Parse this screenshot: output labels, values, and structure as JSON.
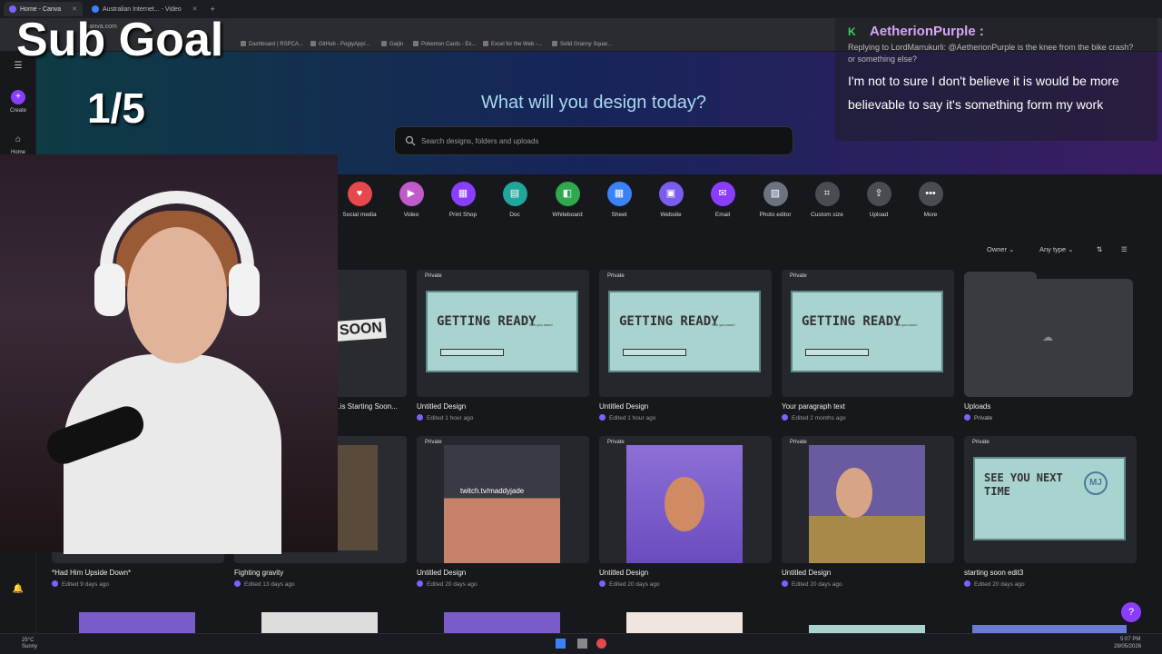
{
  "browser": {
    "tabs": [
      {
        "label": "Home - Canva"
      },
      {
        "label": "Australian Internet... - Video"
      }
    ],
    "url": "canva.com",
    "bookmarks": [
      "Dashboard | RSPCA...",
      "GitHub - PogiyApp/...",
      "Gaijin",
      "Pokemon Cards - Ex...",
      "Excel for the Web -...",
      "Solid Granny Squar..."
    ]
  },
  "sidebar": {
    "create_label": "Create",
    "home_label": "Home"
  },
  "hero": {
    "title": "What will you design today?",
    "search_placeholder": "Search designs, folders and uploads"
  },
  "categories": [
    {
      "label": "Social media",
      "icon": "heart-icon",
      "color": "#e5484d"
    },
    {
      "label": "Video",
      "icon": "video-icon",
      "color": "#c05cc9"
    },
    {
      "label": "Print Shop",
      "icon": "print-icon",
      "color": "#8b3dff"
    },
    {
      "label": "Doc",
      "icon": "doc-icon",
      "color": "#21a69b"
    },
    {
      "label": "Whiteboard",
      "icon": "whiteboard-icon",
      "color": "#2fa84f"
    },
    {
      "label": "Sheet",
      "icon": "sheet-icon",
      "color": "#3b82f6"
    },
    {
      "label": "Website",
      "icon": "website-icon",
      "color": "#7b5cf0"
    },
    {
      "label": "Email",
      "icon": "email-icon",
      "color": "#8b3dff"
    },
    {
      "label": "Photo editor",
      "icon": "photo-icon",
      "color": "#6b7280"
    },
    {
      "label": "Custom size",
      "icon": "crop-icon",
      "color": "#4b4b52"
    },
    {
      "label": "Upload",
      "icon": "upload-icon",
      "color": "#4b4b52"
    },
    {
      "label": "More",
      "icon": "more-icon",
      "color": "#4b4b52"
    }
  ],
  "filters": {
    "owner": "Owner",
    "type": "Any type"
  },
  "designs_row1": [
    {
      "title": "...is Starting Soon...",
      "meta": "",
      "tag": ""
    },
    {
      "title": "Untitled Design",
      "meta": "Edited 1 hour ago",
      "tag": "Private"
    },
    {
      "title": "Untitled Design",
      "meta": "Edited 1 hour ago",
      "tag": "Private"
    },
    {
      "title": "Your paragraph text",
      "meta": "Edited 2 months ago",
      "tag": "Private"
    },
    {
      "title": "Uploads",
      "meta": "Private",
      "tag": ""
    }
  ],
  "designs_row2": [
    {
      "title": "*Had Him Upside Down*",
      "meta": "Edited 9 days ago",
      "tag": ""
    },
    {
      "title": "Fighting gravity",
      "meta": "Edited 13 days ago",
      "tag": ""
    },
    {
      "title": "Untitled Design",
      "meta": "Edited 20 days ago",
      "tag": "Private"
    },
    {
      "title": "Untitled Design",
      "meta": "Edited 20 days ago",
      "tag": "Private"
    },
    {
      "title": "Untitled Design",
      "meta": "Edited 20 days ago",
      "tag": "Private"
    },
    {
      "title": "starting soon edit3",
      "meta": "Edited 20 days ago",
      "tag": "Private"
    }
  ],
  "thumb_text": {
    "getting_ready": "GETTING READY",
    "see_you_soon": "See you soon!",
    "see_you_next": "SEE YOU NEXT TIME",
    "soon": "SOON",
    "twitch": "twitch.tv/maddyjade"
  },
  "overlay": {
    "subgoal_title": "Sub Goal",
    "subgoal_count": "1/5"
  },
  "chat": {
    "username": "AetherionPurple :",
    "reply": "Replying to LordMarrukurli: @AetherionPurple is the knee from the bike crash? or something else?",
    "message": "I'm not to sure I don't believe it is would be more believable to say it's something form my work"
  },
  "taskbar": {
    "weather": "25°C Sunny",
    "time": "5:07 PM",
    "date": "28/05/2026"
  }
}
